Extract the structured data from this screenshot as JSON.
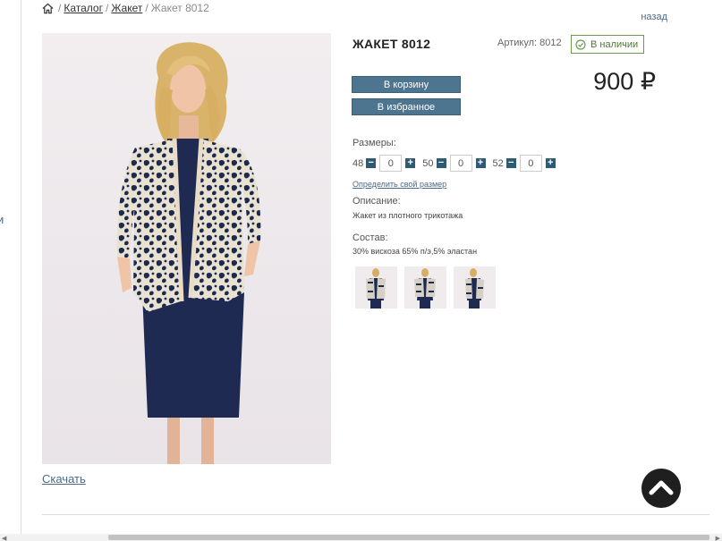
{
  "breadcrumb": {
    "items": [
      "Каталог",
      "Жакет"
    ],
    "current": "Жакет 8012",
    "separator": "/"
  },
  "back_label": "назад",
  "product": {
    "title": "ЖАКЕТ 8012",
    "sku": "Артикул: 8012",
    "stock": "В наличии",
    "price": "900 ₽",
    "cart_label": "В корзину",
    "fav_label": "В избранное",
    "sizes_label": "Размеры:",
    "sizes": [
      {
        "size": "48",
        "qty": "0"
      },
      {
        "size": "50",
        "qty": "0"
      },
      {
        "size": "52",
        "qty": "0"
      }
    ],
    "size_link": "Определить свой размер",
    "description_label": "Описание:",
    "description": "Жакет из плотного трикотажа",
    "composition_label": "Состав:",
    "composition": "30% вискоза 65% п/э,5% эластан"
  },
  "download_label": "Скачать",
  "colors": {
    "accent": "#4e7590",
    "stock_green": "#4c7a30",
    "link": "#4a6a86",
    "scroll_top_bg": "#1f1f1f"
  },
  "icons": {
    "home": "home-icon",
    "stock": "check-circle-icon",
    "scroll_top": "chevron-up-icon",
    "minus": "minus-icon",
    "plus": "plus-icon"
  }
}
